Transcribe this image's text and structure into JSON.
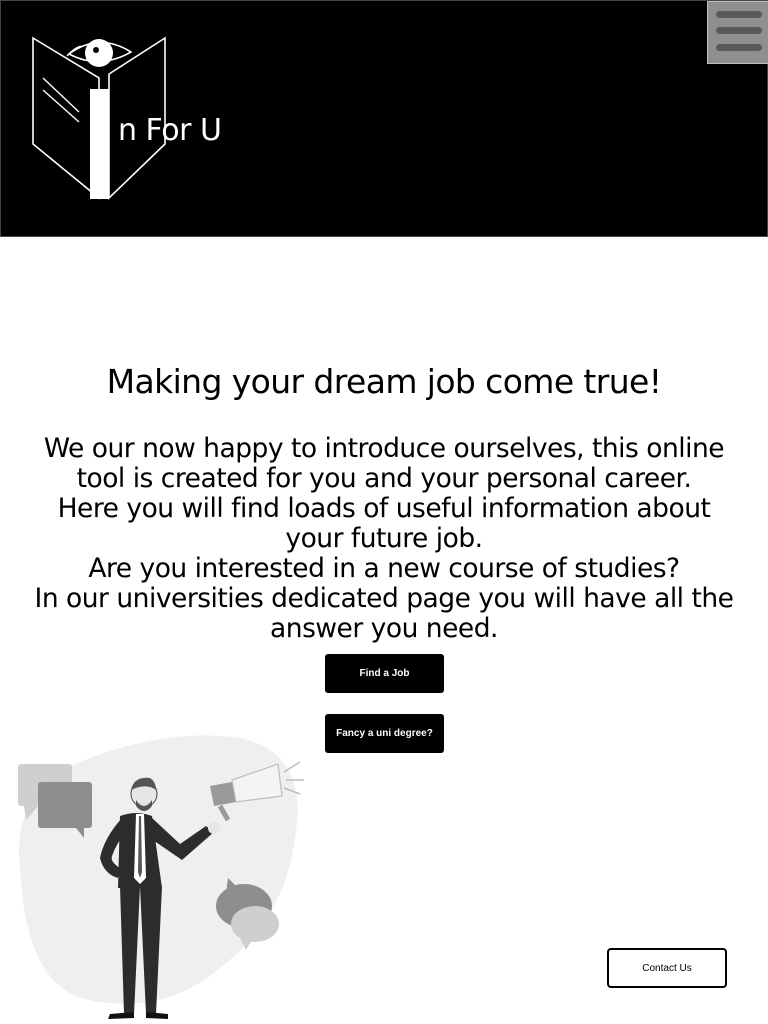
{
  "header": {
    "logo_text": "n For U",
    "logo_icon": "book-eye-logo",
    "menu_icon": "hamburger-icon",
    "background": "#000000"
  },
  "main": {
    "headline": "Making your dream job come true!",
    "intro_lines": [
      "We our now happy to introduce ourselves, this online",
      "tool is created for you and your personal career.",
      "Here you will find loads of useful information about",
      "your future job.",
      "Are you interested in a new course of studies?",
      "In our universities dedicated page you will have all the",
      "answer you need."
    ],
    "find_job_label": "Find a Job",
    "uni_degree_label": "Fancy a uni degree?",
    "illustration": "businessman-with-speech-bubbles-illustration"
  },
  "footer": {
    "contact_label": "Contact Us"
  }
}
